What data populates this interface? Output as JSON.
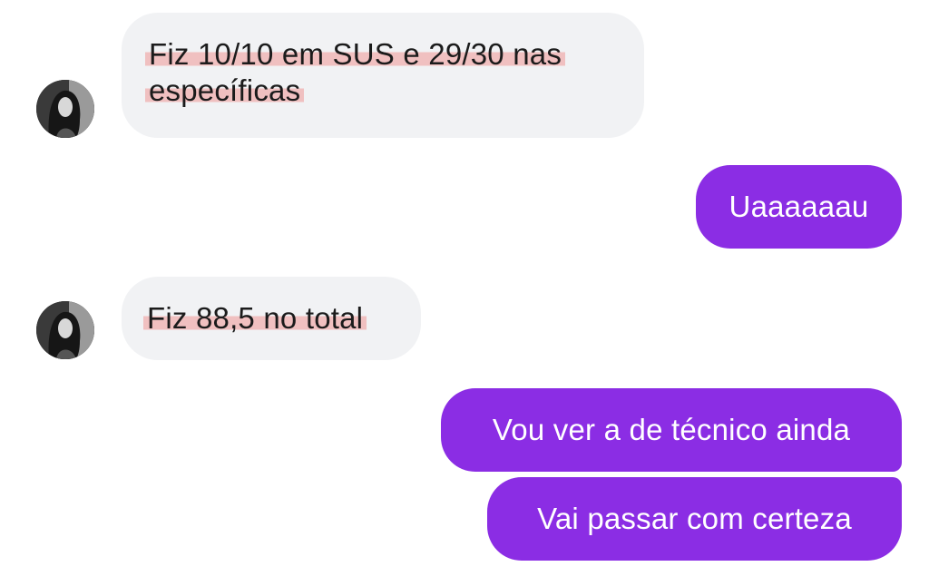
{
  "conversation": {
    "messages": [
      {
        "side": "incoming",
        "lines": [
          "Fiz 10/10 em SUS e 29/30 nas",
          "específicas"
        ]
      },
      {
        "side": "outgoing",
        "text": "Uaaaaaau"
      },
      {
        "side": "incoming",
        "text": "Fiz 88,5 no total"
      },
      {
        "side": "outgoing",
        "text": "Vou ver a de técnico ainda"
      },
      {
        "side": "outgoing",
        "text": "Vai passar com certeza"
      }
    ]
  },
  "colors": {
    "incoming_bubble": "#f1f2f4",
    "outgoing_bubble": "#8b2de4",
    "highlight": "#f09696"
  },
  "icons": {
    "avatar": "contact-avatar-photo"
  }
}
